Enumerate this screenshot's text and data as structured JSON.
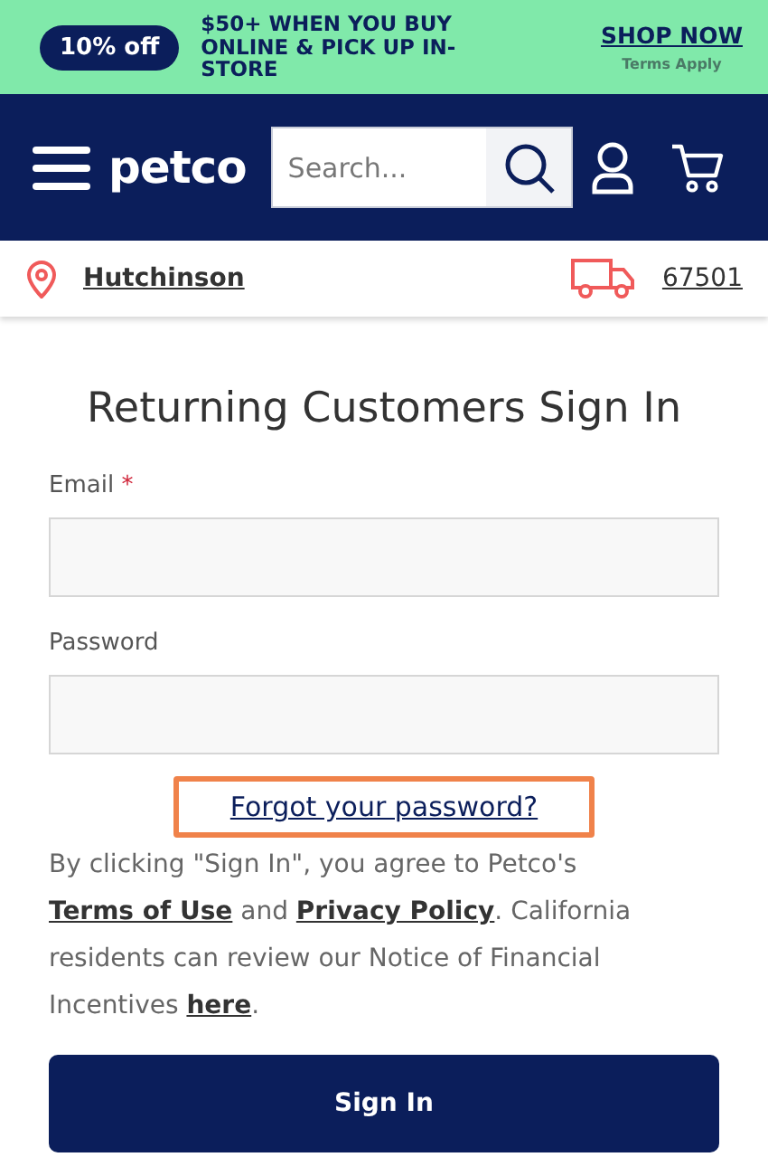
{
  "promo": {
    "badge": "10% off",
    "message": "$50+ WHEN YOU BUY ONLINE & PICK UP IN-STORE",
    "cta": "SHOP NOW",
    "note": "Terms Apply"
  },
  "header": {
    "logo": "petco",
    "search": {
      "placeholder": "Search..."
    }
  },
  "location": {
    "store": "Hutchinson",
    "zip": "67501"
  },
  "form": {
    "title": "Returning Customers Sign In",
    "required_mark": "*",
    "fields": [
      {
        "label": "Email",
        "required": true
      },
      {
        "label": "Password",
        "required": false
      }
    ],
    "forgot": {
      "text": "Forgot your password?",
      "highlighted": true
    },
    "legal": [
      {
        "kind": "text",
        "text": "By clicking \"Sign In\", you agree to Petco's "
      },
      {
        "kind": "link",
        "text": "Terms of Use"
      },
      {
        "kind": "text",
        "text": " and "
      },
      {
        "kind": "link",
        "text": "Privacy Policy"
      },
      {
        "kind": "text",
        "text": ". California residents can review our Notice of Financial Incentives "
      },
      {
        "kind": "link",
        "text": "here"
      },
      {
        "kind": "text",
        "text": "."
      }
    ],
    "button": "Sign In"
  }
}
